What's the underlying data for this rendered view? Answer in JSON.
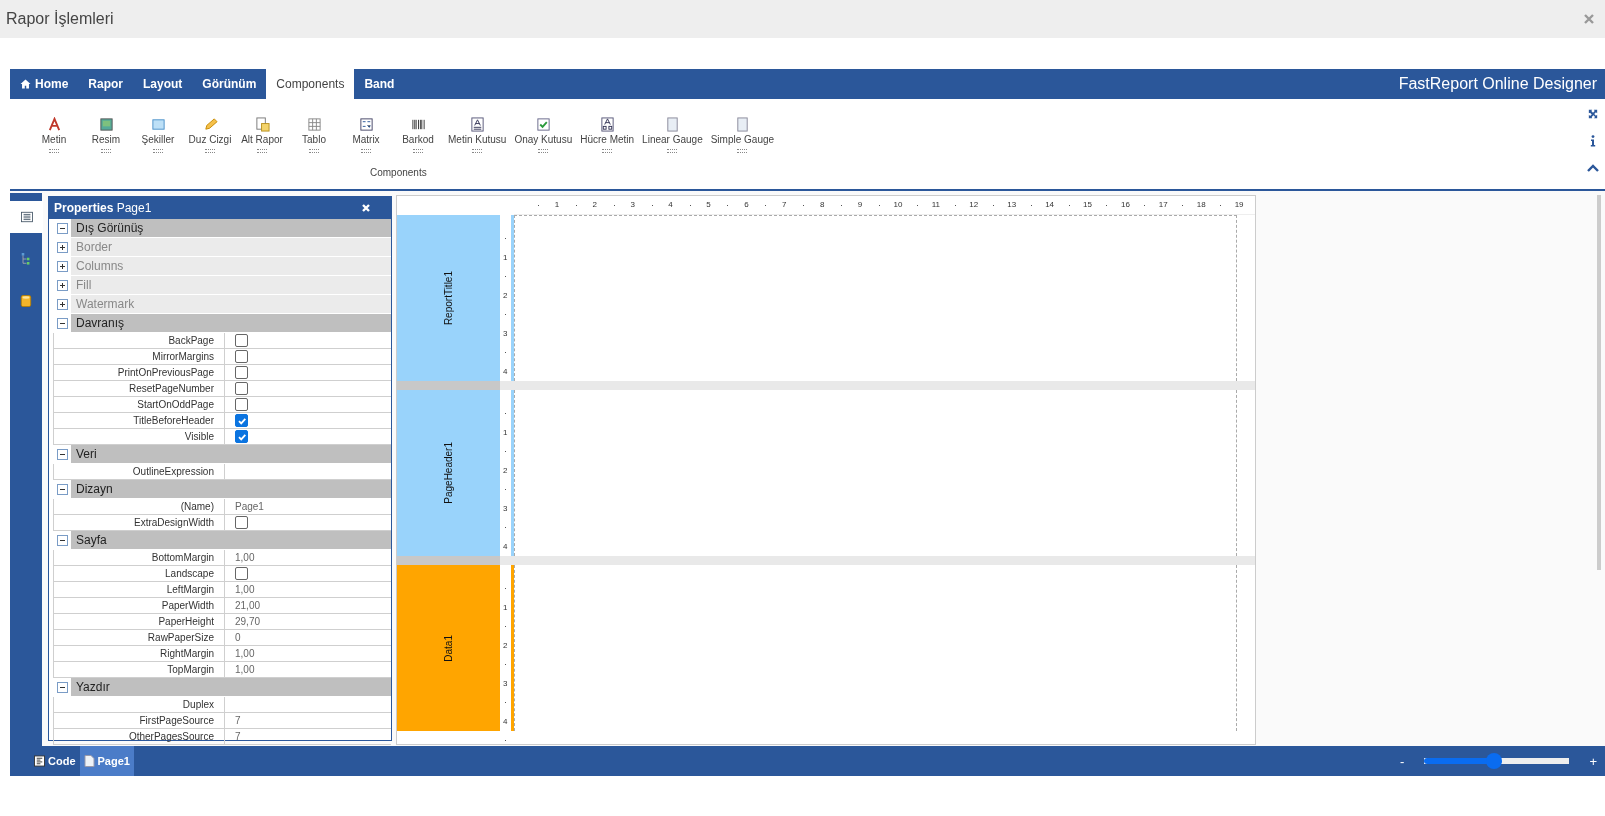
{
  "window": {
    "title": "Rapor İşlemleri"
  },
  "menu": {
    "tabs": [
      {
        "label": "Home",
        "has_icon": true,
        "selected": false
      },
      {
        "label": "Rapor",
        "has_icon": false,
        "selected": false
      },
      {
        "label": "Layout",
        "has_icon": false,
        "selected": false
      },
      {
        "label": "Görünüm",
        "has_icon": false,
        "selected": false
      },
      {
        "label": "Components",
        "has_icon": false,
        "selected": true
      },
      {
        "label": "Band",
        "has_icon": false,
        "selected": false
      }
    ],
    "brand": "FastReport Online Designer"
  },
  "ribbon": {
    "items": [
      {
        "label": "Metin"
      },
      {
        "label": "Resim"
      },
      {
        "label": "Şekiller"
      },
      {
        "label": "Duz Cizgi"
      },
      {
        "label": "Alt Rapor"
      },
      {
        "label": "Tablo"
      },
      {
        "label": "Matrix"
      },
      {
        "label": "Barkod"
      },
      {
        "label": "Metin Kutusu"
      },
      {
        "label": "Onay Kutusu"
      },
      {
        "label": "Hücre Metin"
      },
      {
        "label": "Linear Gauge"
      },
      {
        "label": "Simple Gauge"
      }
    ],
    "group_label": "Components"
  },
  "side_tabs": [
    {
      "selected": true
    },
    {
      "selected": false
    },
    {
      "selected": false
    }
  ],
  "properties": {
    "title": "Properties",
    "object": "Page1",
    "groups": [
      {
        "name": "Dış Görünüş",
        "expanded": true,
        "subgroups": [
          {
            "name": "Border",
            "expanded": false
          },
          {
            "name": "Columns",
            "expanded": false
          },
          {
            "name": "Fill",
            "expanded": false
          },
          {
            "name": "Watermark",
            "expanded": false
          }
        ]
      },
      {
        "name": "Davranış",
        "expanded": true,
        "rows": [
          {
            "name": "BackPage",
            "kind": "checkbox",
            "checked": false
          },
          {
            "name": "MirrorMargins",
            "kind": "checkbox",
            "checked": false
          },
          {
            "name": "PrintOnPreviousPage",
            "kind": "checkbox",
            "checked": false
          },
          {
            "name": "ResetPageNumber",
            "kind": "checkbox",
            "checked": false
          },
          {
            "name": "StartOnOddPage",
            "kind": "checkbox",
            "checked": false
          },
          {
            "name": "TitleBeforeHeader",
            "kind": "checkbox",
            "checked": true
          },
          {
            "name": "Visible",
            "kind": "checkbox",
            "checked": true
          }
        ]
      },
      {
        "name": "Veri",
        "expanded": true,
        "rows": [
          {
            "name": "OutlineExpression",
            "kind": "text"
          }
        ]
      },
      {
        "name": "Dizayn",
        "expanded": true,
        "rows": [
          {
            "name": "(Name)",
            "kind": "text",
            "value": "Page1"
          },
          {
            "name": "ExtraDesignWidth",
            "kind": "checkbox",
            "checked": false
          }
        ]
      },
      {
        "name": "Sayfa",
        "expanded": true,
        "rows": [
          {
            "name": "BottomMargin",
            "kind": "text",
            "value": "1,00"
          },
          {
            "name": "Landscape",
            "kind": "checkbox",
            "checked": false
          },
          {
            "name": "LeftMargin",
            "kind": "text",
            "value": "1,00"
          },
          {
            "name": "PaperWidth",
            "kind": "text",
            "value": "21,00"
          },
          {
            "name": "PaperHeight",
            "kind": "text",
            "value": "29,70"
          },
          {
            "name": "RawPaperSize",
            "kind": "text",
            "value": "0"
          },
          {
            "name": "RightMargin",
            "kind": "text",
            "value": "1,00"
          },
          {
            "name": "TopMargin",
            "kind": "text",
            "value": "1,00"
          }
        ]
      },
      {
        "name": "Yazdır",
        "expanded": true,
        "rows": [
          {
            "name": "Duplex",
            "kind": "text"
          },
          {
            "name": "FirstPageSource",
            "kind": "text",
            "value": "7"
          },
          {
            "name": "OtherPagesSource",
            "kind": "text",
            "value": "7"
          }
        ]
      }
    ]
  },
  "designer": {
    "ruler": [
      "1",
      "2",
      "3",
      "4",
      "5",
      "6",
      "7",
      "8",
      "9",
      "10",
      "11",
      "12",
      "13",
      "14",
      "15",
      "16",
      "17",
      "18",
      "19"
    ],
    "bands": [
      {
        "name": "ReportTitle1",
        "color": "#99d3fb",
        "ruler": [
          "1",
          "2",
          "3",
          "4"
        ]
      },
      {
        "name": "PageHeader1",
        "color": "#99d3fb",
        "ruler": [
          "1",
          "2",
          "3",
          "4"
        ]
      },
      {
        "name": "Data1",
        "color": "#ffa500",
        "ruler": [
          "1",
          "2",
          "3",
          "4"
        ]
      }
    ]
  },
  "footer": {
    "tabs": [
      {
        "label": "Code",
        "selected": false
      },
      {
        "label": "Page1",
        "selected": true
      }
    ],
    "zoom": {
      "minus": "-",
      "plus": "+",
      "level": 0.48
    }
  }
}
